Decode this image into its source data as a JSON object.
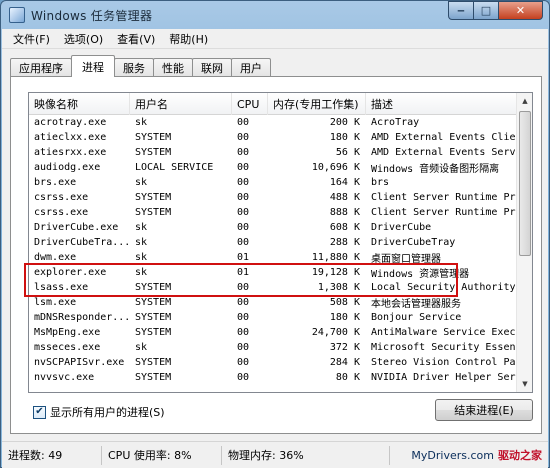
{
  "window": {
    "title": "Windows 任务管理器"
  },
  "menu": [
    "文件(F)",
    "选项(O)",
    "查看(V)",
    "帮助(H)"
  ],
  "tabs": [
    "应用程序",
    "进程",
    "服务",
    "性能",
    "联网",
    "用户"
  ],
  "active_tab": "进程",
  "columns": [
    "映像名称",
    "用户名",
    "CPU",
    "内存(专用工作集)",
    "描述"
  ],
  "processes": [
    {
      "name": "acrotray.exe",
      "user": "sk",
      "cpu": "00",
      "mem": "200 K",
      "desc": "AcroTray"
    },
    {
      "name": "atieclxx.exe",
      "user": "SYSTEM",
      "cpu": "00",
      "mem": "180 K",
      "desc": "AMD External Events Clie"
    },
    {
      "name": "atiesrxx.exe",
      "user": "SYSTEM",
      "cpu": "00",
      "mem": "56 K",
      "desc": "AMD External Events Serv"
    },
    {
      "name": "audiodg.exe",
      "user": "LOCAL SERVICE",
      "cpu": "00",
      "mem": "10,696 K",
      "desc": "Windows 音频设备图形隔离"
    },
    {
      "name": "brs.exe",
      "user": "sk",
      "cpu": "00",
      "mem": "164 K",
      "desc": "brs"
    },
    {
      "name": "csrss.exe",
      "user": "SYSTEM",
      "cpu": "00",
      "mem": "488 K",
      "desc": "Client Server Runtime Pr"
    },
    {
      "name": "csrss.exe",
      "user": "SYSTEM",
      "cpu": "00",
      "mem": "888 K",
      "desc": "Client Server Runtime Pr"
    },
    {
      "name": "DriverCube.exe",
      "user": "sk",
      "cpu": "00",
      "mem": "608 K",
      "desc": "DriverCube"
    },
    {
      "name": "DriverCubeTra...",
      "user": "sk",
      "cpu": "00",
      "mem": "288 K",
      "desc": "DriverCubeTray"
    },
    {
      "name": "dwm.exe",
      "user": "sk",
      "cpu": "01",
      "mem": "11,880 K",
      "desc": "桌面窗口管理器"
    },
    {
      "name": "explorer.exe",
      "user": "sk",
      "cpu": "01",
      "mem": "19,128 K",
      "desc": "Windows 资源管理器"
    },
    {
      "name": "lsass.exe",
      "user": "SYSTEM",
      "cpu": "00",
      "mem": "1,308 K",
      "desc": "Local Security Authority"
    },
    {
      "name": "lsm.exe",
      "user": "SYSTEM",
      "cpu": "00",
      "mem": "508 K",
      "desc": "本地会话管理器服务"
    },
    {
      "name": "mDNSResponder....",
      "user": "SYSTEM",
      "cpu": "00",
      "mem": "180 K",
      "desc": "Bonjour Service"
    },
    {
      "name": "MsMpEng.exe",
      "user": "SYSTEM",
      "cpu": "00",
      "mem": "24,700 K",
      "desc": "AntiMalware Service Exec"
    },
    {
      "name": "msseces.exe",
      "user": "sk",
      "cpu": "00",
      "mem": "372 K",
      "desc": "Microsoft Security Essen"
    },
    {
      "name": "nvSCPAPISvr.exe",
      "user": "SYSTEM",
      "cpu": "00",
      "mem": "284 K",
      "desc": "Stereo Vision Control Pa"
    },
    {
      "name": "nvvsvc.exe",
      "user": "SYSTEM",
      "cpu": "00",
      "mem": "80 K",
      "desc": "NVIDIA Driver Helper Ser"
    }
  ],
  "show_all_users": {
    "label": "显示所有用户的进程(S)",
    "checked": true
  },
  "end_process_label": "结束进程(E)",
  "status": {
    "processes": "进程数: 49",
    "cpu": "CPU 使用率: 8%",
    "memory": "物理内存: 36%"
  },
  "watermark": {
    "site": "MyDrivers.com",
    "brand": "驱动之家"
  },
  "colors": {
    "highlight_border": "#d01010",
    "title_bar": "#7fb0d9"
  }
}
